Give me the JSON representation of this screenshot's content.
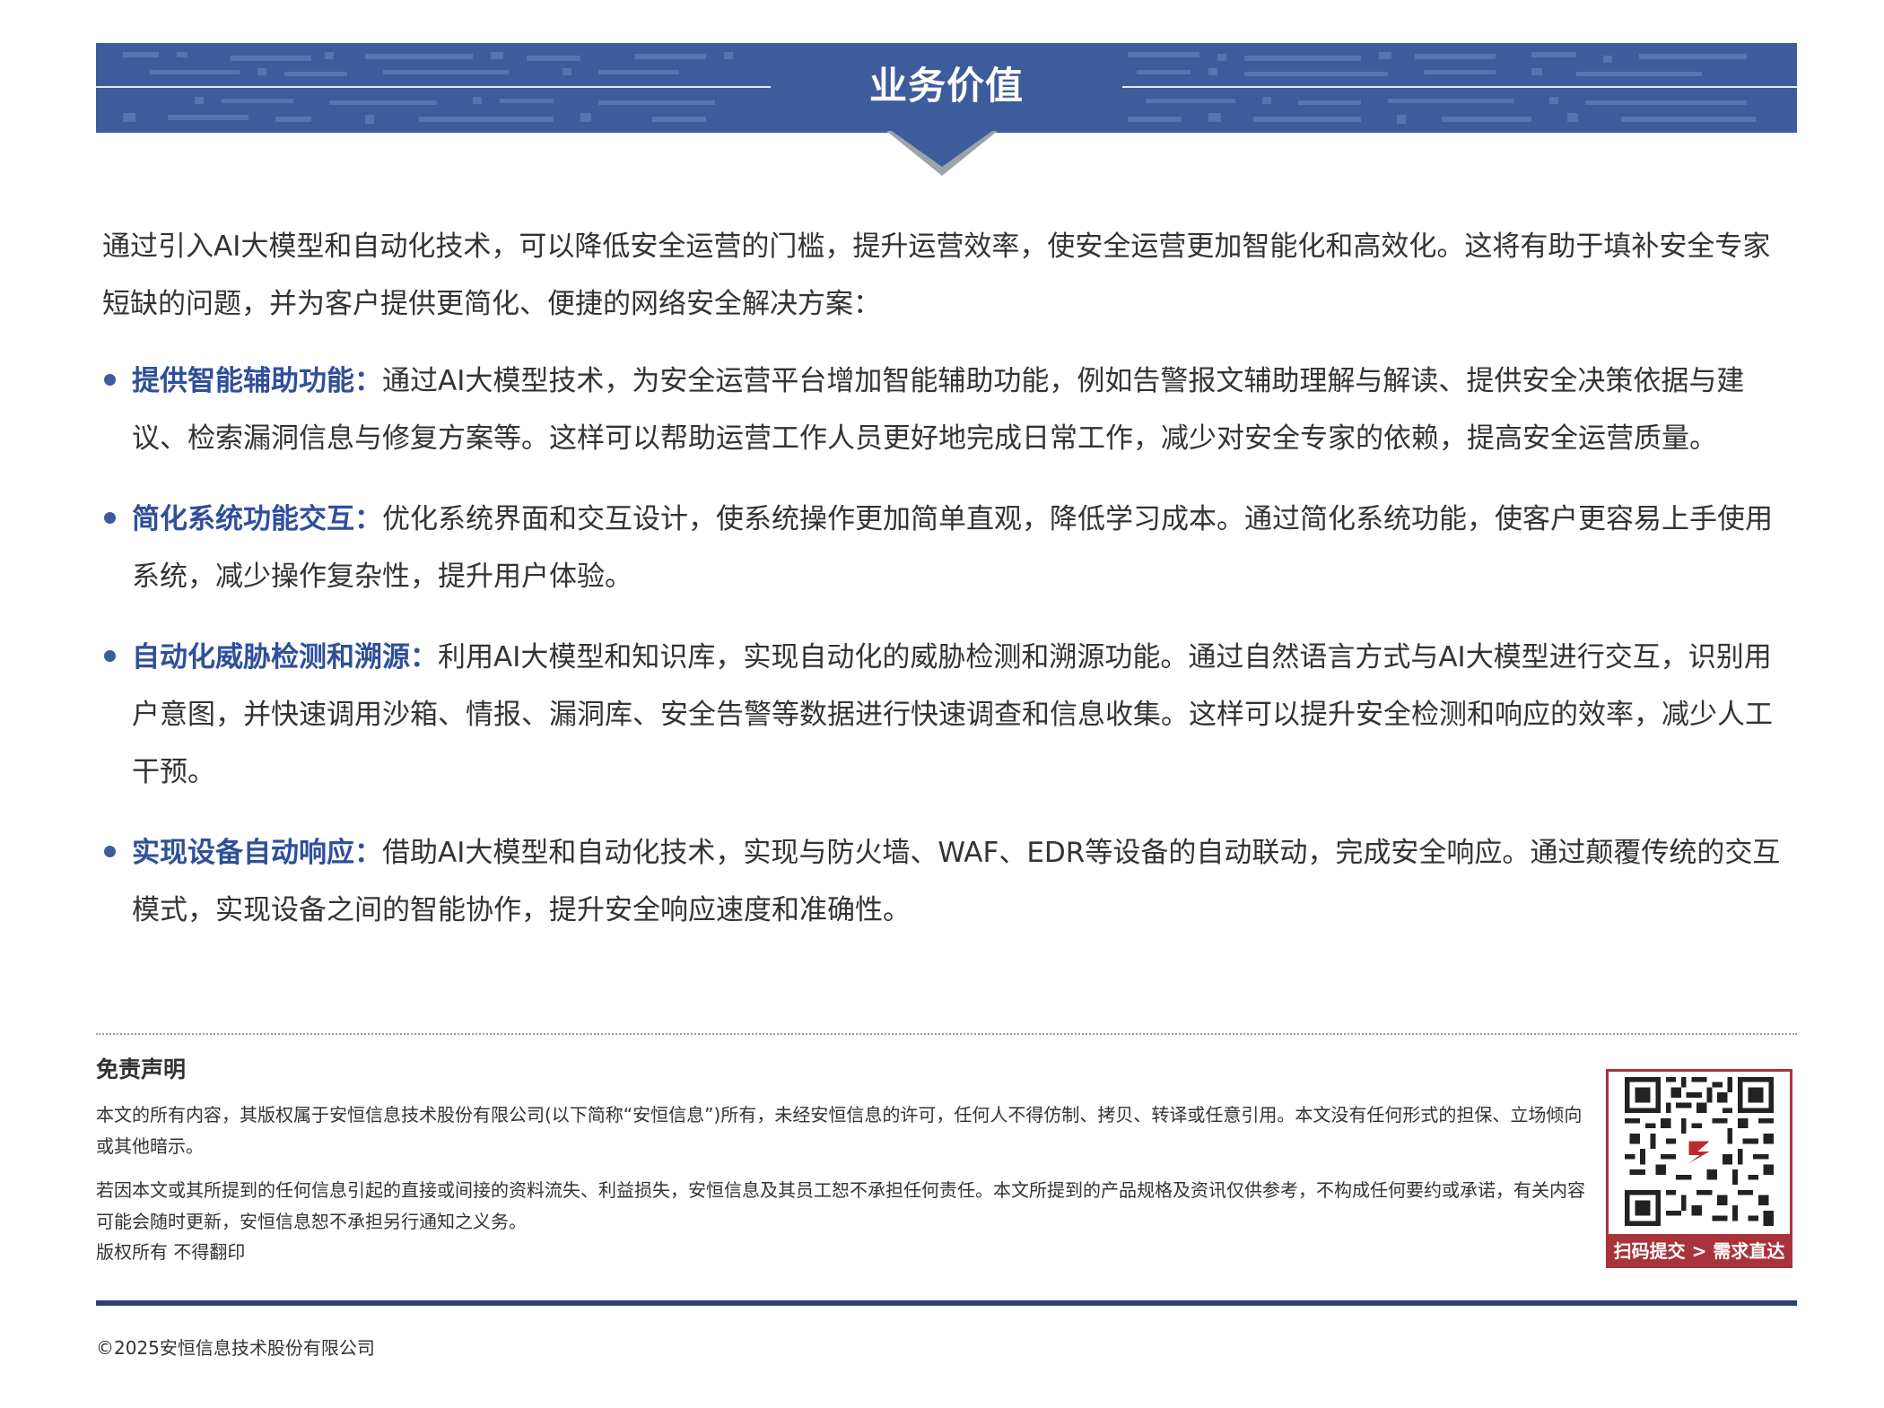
{
  "header": {
    "title": "业务价值"
  },
  "intro": "通过引入AI大模型和自动化技术，可以降低安全运营的门槛，提升运营效率，使安全运营更加智能化和高效化。这将有助于填补安全专家短缺的问题，并为客户提供更简化、便捷的网络安全解决方案：",
  "bullets": [
    {
      "title": "提供智能辅助功能：",
      "text": "通过AI大模型技术，为安全运营平台增加智能辅助功能，例如告警报文辅助理解与解读、提供安全决策依据与建议、检索漏洞信息与修复方案等。这样可以帮助运营工作人员更好地完成日常工作，减少对安全专家的依赖，提高安全运营质量。"
    },
    {
      "title": "简化系统功能交互：",
      "text": "优化系统界面和交互设计，使系统操作更加简单直观，降低学习成本。通过简化系统功能，使客户更容易上手使用系统，减少操作复杂性，提升用户体验。"
    },
    {
      "title": "自动化威胁检测和溯源：",
      "text": "利用AI大模型和知识库，实现自动化的威胁检测和溯源功能。通过自然语言方式与AI大模型进行交互，识别用户意图，并快速调用沙箱、情报、漏洞库、安全告警等数据进行快速调查和信息收集。这样可以提升安全检测和响应的效率，减少人工干预。"
    },
    {
      "title": "实现设备自动响应：",
      "text": "借助AI大模型和自动化技术，实现与防火墙、WAF、EDR等设备的自动联动，完成安全响应。通过颠覆传统的交互模式，实现设备之间的智能协作，提升安全响应速度和准确性。"
    }
  ],
  "disclaimer": {
    "title": "免责声明",
    "paragraph1": "本文的所有内容，其版权属于安恒信息技术股份有限公司(以下简称“安恒信息”)所有，未经安恒信息的许可，任何人不得仿制、拷贝、转译或任意引用。本文没有任何形式的担保、立场倾向或其他暗示。",
    "paragraph2": "若因本文或其所提到的任何信息引起的直接或间接的资料流失、利益损失，安恒信息及其员工恕不承担任何责任。本文所提到的产品规格及资讯仅供参考，不构成任何要约或承诺，有关内容可能会随时更新，安恒信息恕不承担另行通知之义务。",
    "rights": "版权所有 不得翻印"
  },
  "qr": {
    "caption": "扫码提交 > 需求直达"
  },
  "footer": {
    "copyright": "©2025安恒信息技术股份有限公司"
  },
  "colors": {
    "banner": "#3d5c9c",
    "accent": "#2f4f9a",
    "qr_frame": "#a9333a",
    "footer_rule": "#2e3f7a"
  }
}
